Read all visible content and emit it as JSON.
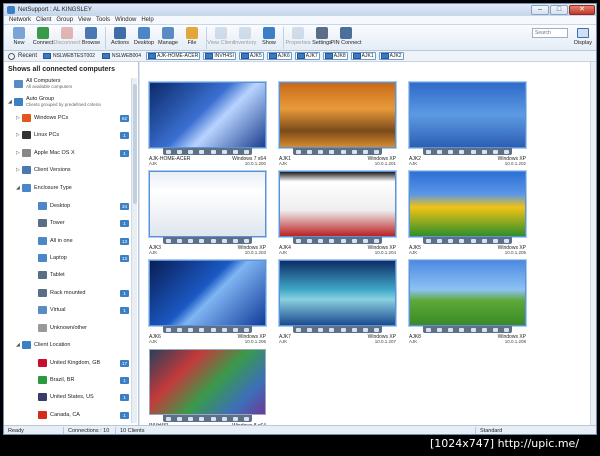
{
  "window": {
    "title": "NetSupport : AL KINGSLEY",
    "minimize": "–",
    "maximize": "□",
    "close": "✕"
  },
  "menu": [
    "Network",
    "Client",
    "Group",
    "View",
    "Tools",
    "Window",
    "Help"
  ],
  "toolbar": {
    "buttons": [
      {
        "label": "New",
        "icon": "new-icon",
        "color": "#7aa4d6",
        "disabled": false
      },
      {
        "label": "Connect",
        "icon": "connect-icon",
        "color": "#3b9a4a",
        "disabled": false
      },
      {
        "label": "Disconnect",
        "icon": "disconnect-icon",
        "color": "#c0392b",
        "disabled": true
      },
      {
        "label": "Browse",
        "icon": "browse-icon",
        "color": "#4a78b0",
        "disabled": false
      },
      {
        "label": "Actions",
        "icon": "actions-icon",
        "color": "#3d6ea8",
        "disabled": false
      },
      {
        "label": "Desktop",
        "icon": "desktop-icon",
        "color": "#4a86c8",
        "disabled": false
      },
      {
        "label": "Manage",
        "icon": "manage-icon",
        "color": "#5b8bc4",
        "disabled": false
      },
      {
        "label": "File",
        "icon": "file-icon",
        "color": "#e1a73b",
        "disabled": false
      },
      {
        "label": "View Client",
        "icon": "view-client-icon",
        "color": "#8fa9c8",
        "disabled": true
      },
      {
        "label": "Inventory",
        "icon": "inventory-icon",
        "color": "#8fa9c8",
        "disabled": true
      },
      {
        "label": "Show",
        "icon": "show-icon",
        "color": "#3d7fc4",
        "disabled": false
      },
      {
        "label": "Properties",
        "icon": "properties-icon",
        "color": "#8fa9c8",
        "disabled": true
      },
      {
        "label": "Settings",
        "icon": "settings-icon",
        "color": "#5a6e86",
        "disabled": false
      },
      {
        "label": "PIN Connect",
        "icon": "pin-connect-icon",
        "color": "#4a6f9a",
        "disabled": false
      }
    ],
    "search_placeholder": "Search",
    "display_label": "Display"
  },
  "recent": {
    "label": "Recent",
    "machines": [
      "NSLWEBTEST002",
      "NSLWEB004",
      "AJK-HOME-ACER",
      "INVH4SI",
      "AJK5",
      "AJK6",
      "AJK7",
      "AJK8",
      "AJK1",
      "AJK2"
    ]
  },
  "sidebar": {
    "heading": "Shows all connected computers",
    "items": [
      {
        "label": "All Computers",
        "sub": "All available computers",
        "icon": "computers-icon",
        "count": ""
      },
      {
        "label": "Auto Group",
        "sub": "Clients grouped by predefined criteria",
        "icon": "auto-group-icon",
        "count": ""
      },
      {
        "label": "Windows PCs",
        "sub": "",
        "icon": "windows-icon",
        "count": "62"
      },
      {
        "label": "Linux PCs",
        "sub": "",
        "icon": "linux-icon",
        "count": "1"
      },
      {
        "label": "Apple Mac OS X",
        "sub": "",
        "icon": "apple-icon",
        "count": "1"
      },
      {
        "label": "Client Versions",
        "sub": "",
        "icon": "client-versions-icon",
        "count": ""
      },
      {
        "label": "Enclosure Type",
        "sub": "",
        "icon": "enclosure-icon",
        "count": ""
      },
      {
        "label": "Desktop",
        "sub": "",
        "icon": "desktop-pc-icon",
        "count": "34"
      },
      {
        "label": "Tower",
        "sub": "",
        "icon": "tower-icon",
        "count": "1"
      },
      {
        "label": "All in one",
        "sub": "",
        "icon": "all-in-one-icon",
        "count": "13"
      },
      {
        "label": "Laptop",
        "sub": "",
        "icon": "laptop-icon",
        "count": "13"
      },
      {
        "label": "Tablet",
        "sub": "",
        "icon": "tablet-icon",
        "count": ""
      },
      {
        "label": "Rack mounted",
        "sub": "",
        "icon": "rack-icon",
        "count": "1"
      },
      {
        "label": "Virtual",
        "sub": "",
        "icon": "virtual-icon",
        "count": "1"
      },
      {
        "label": "Unknown/other",
        "sub": "",
        "icon": "unknown-icon",
        "count": ""
      },
      {
        "label": "Client Location",
        "sub": "",
        "icon": "location-pin-icon",
        "count": ""
      },
      {
        "label": "United Kingdom, GB",
        "sub": "",
        "icon": "flag-gb-icon",
        "count": "17"
      },
      {
        "label": "Brazil, BR",
        "sub": "",
        "icon": "flag-br-icon",
        "count": "1"
      },
      {
        "label": "United States, US",
        "sub": "",
        "icon": "flag-us-icon",
        "count": "1"
      },
      {
        "label": "Canada, CA",
        "sub": "",
        "icon": "flag-ca-icon",
        "count": "1"
      }
    ]
  },
  "clients": [
    {
      "name": "AJK-HOME-ACER",
      "os": "Windows 7 x64",
      "user": "AJK",
      "ip": "10.0.1.200"
    },
    {
      "name": "AJK1",
      "os": "Windows XP",
      "user": "AJK",
      "ip": "10.0.1.201"
    },
    {
      "name": "AJK2",
      "os": "Windows XP",
      "user": "AJK",
      "ip": "10.0.1.202"
    },
    {
      "name": "AJK3",
      "os": "Windows XP",
      "user": "AJK",
      "ip": "10.0.1.203"
    },
    {
      "name": "AJK4",
      "os": "Windows XP",
      "user": "AJK",
      "ip": "10.0.1.204"
    },
    {
      "name": "AJK5",
      "os": "Windows XP",
      "user": "AJK",
      "ip": "10.0.1.205"
    },
    {
      "name": "AJK6",
      "os": "Windows XP",
      "user": "AJK",
      "ip": "10.0.1.206"
    },
    {
      "name": "AJK7",
      "os": "Windows XP",
      "user": "AJK",
      "ip": "10.0.1.207"
    },
    {
      "name": "AJK8",
      "os": "Windows XP",
      "user": "AJK",
      "ip": "10.0.1.208"
    },
    {
      "name": "INVH4SI",
      "os": "Windows 8 x64",
      "user": "",
      "ip": ""
    }
  ],
  "status": {
    "ready": "Ready",
    "connections": "Connections : 10",
    "clients": "10 Clients",
    "mode": "Standard"
  },
  "watermark": "[1024x747] http://upic.me/",
  "colors": {
    "accent": "#3d7fc4",
    "window_bg": "#dde7f3"
  }
}
